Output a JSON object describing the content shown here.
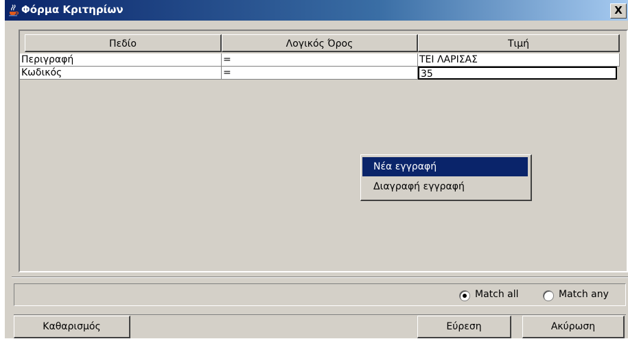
{
  "window": {
    "title": "Φόρμα Κριτηρίων",
    "close_label": "X"
  },
  "table": {
    "columns": [
      "Πεδίο",
      "Λογικός Όρος",
      "Τιμή"
    ],
    "rows": [
      [
        "Περιγραφή",
        "=",
        "ΤΕΙ ΛΑΡΙΣΑΣ"
      ],
      [
        "Κωδικός",
        "=",
        "35"
      ]
    ]
  },
  "context_menu": {
    "items": [
      "Νέα εγγραφή",
      "Διαγραφή εγγραφή"
    ]
  },
  "match": {
    "all_label": "Match all",
    "any_label": "Match any",
    "selected": "all"
  },
  "buttons": {
    "clear": "Καθαρισμός",
    "find": "Εύρεση",
    "cancel": "Ακύρωση"
  }
}
